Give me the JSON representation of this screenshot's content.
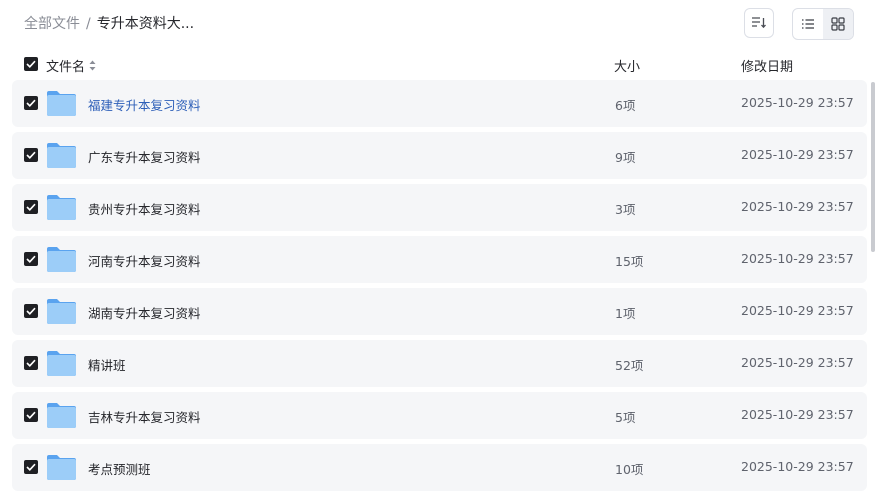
{
  "breadcrumb": {
    "root": "全部文件",
    "separator": "/",
    "current": "专升本资料大..."
  },
  "toolbar": {
    "sort_icon": "sort-icon",
    "list_view_icon": "list-view-icon",
    "grid_view_icon": "grid-view-icon"
  },
  "columns": {
    "name": "文件名",
    "size": "大小",
    "date": "修改日期"
  },
  "files": [
    {
      "name": "福建专升本复习资料",
      "size": "6项",
      "date": "2025-10-29 23:57"
    },
    {
      "name": "广东专升本复习资料",
      "size": "9项",
      "date": "2025-10-29 23:57"
    },
    {
      "name": "贵州专升本复习资料",
      "size": "3项",
      "date": "2025-10-29 23:57"
    },
    {
      "name": "河南专升本复习资料",
      "size": "15项",
      "date": "2025-10-29 23:57"
    },
    {
      "name": "湖南专升本复习资料",
      "size": "1项",
      "date": "2025-10-29 23:57"
    },
    {
      "name": "精讲班",
      "size": "52项",
      "date": "2025-10-29 23:57"
    },
    {
      "name": "吉林专升本复习资料",
      "size": "5项",
      "date": "2025-10-29 23:57"
    },
    {
      "name": "考点预测班",
      "size": "10项",
      "date": "2025-10-29 23:57"
    }
  ],
  "colors": {
    "folder": "#7ab8f5",
    "link": "#2d5fb8",
    "row_bg": "#f5f6f8"
  }
}
